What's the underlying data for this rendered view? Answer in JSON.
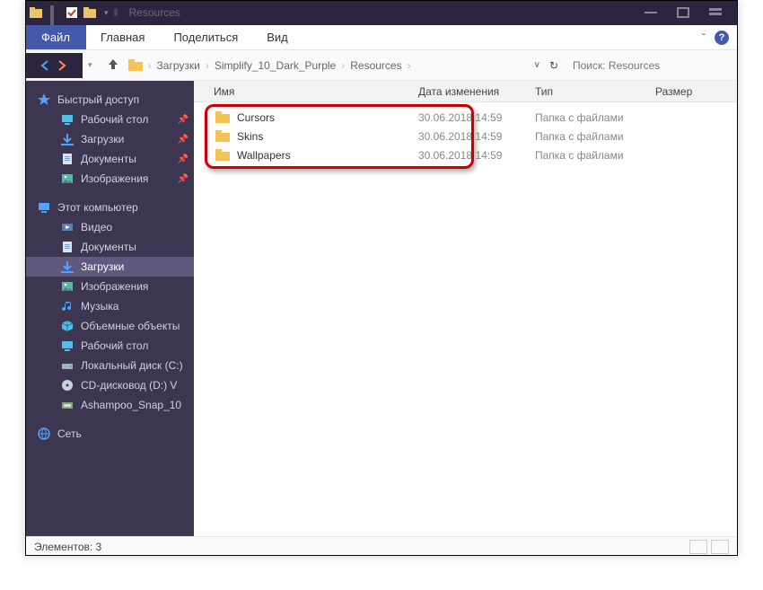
{
  "titlebar": {
    "title": "Resources"
  },
  "ribbon": {
    "file": "Файл",
    "tabs": [
      "Главная",
      "Поделиться",
      "Вид"
    ]
  },
  "breadcrumbs": [
    "Загрузки",
    "Simplify_10_Dark_Purple",
    "Resources"
  ],
  "search": {
    "placeholder": "Поиск: Resources"
  },
  "columns": {
    "name": "Имя",
    "date": "Дата изменения",
    "type": "Тип",
    "size": "Размер"
  },
  "folders": [
    {
      "name": "Cursors",
      "date": "30.06.2018 14:59",
      "type": "Папка с файлами"
    },
    {
      "name": "Skins",
      "date": "30.06.2018 14:59",
      "type": "Папка с файлами"
    },
    {
      "name": "Wallpapers",
      "date": "30.06.2018 14:59",
      "type": "Папка с файлами"
    }
  ],
  "sidebar": {
    "quick_access": "Быстрый доступ",
    "quick": [
      {
        "label": "Рабочий стол",
        "icon": "desktop",
        "pinned": true
      },
      {
        "label": "Загрузки",
        "icon": "download",
        "pinned": true
      },
      {
        "label": "Документы",
        "icon": "document",
        "pinned": true
      },
      {
        "label": "Изображения",
        "icon": "picture",
        "pinned": true
      }
    ],
    "this_pc": "Этот компьютер",
    "pc": [
      {
        "label": "Видео",
        "icon": "video"
      },
      {
        "label": "Документы",
        "icon": "document"
      },
      {
        "label": "Загрузки",
        "icon": "download",
        "selected": true
      },
      {
        "label": "Изображения",
        "icon": "picture"
      },
      {
        "label": "Музыка",
        "icon": "music"
      },
      {
        "label": "Объемные объекты",
        "icon": "3d"
      },
      {
        "label": "Рабочий стол",
        "icon": "desktop"
      },
      {
        "label": "Локальный диск (C:)",
        "icon": "drive"
      },
      {
        "label": "CD-дисковод (D:) V",
        "icon": "cd"
      },
      {
        "label": "Ashampoo_Snap_10",
        "icon": "disk"
      }
    ],
    "network": "Сеть"
  },
  "status": {
    "count_label": "Элементов: 3"
  }
}
